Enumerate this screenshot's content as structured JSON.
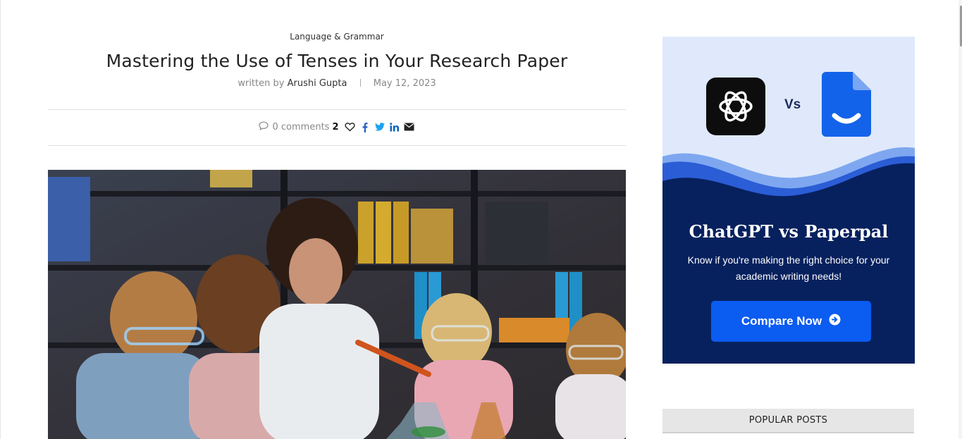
{
  "article": {
    "category": "Language & Grammar",
    "title": "Mastering the Use of Tenses in Your Research Paper",
    "written_by_label": "written by",
    "author": "Arushi Gupta",
    "date": "May 12, 2023",
    "comments": "0 comments",
    "likes": "2",
    "share_icons": [
      "comment-icon",
      "heart-icon",
      "facebook-icon",
      "twitter-icon",
      "linkedin-icon",
      "email-icon"
    ]
  },
  "ad": {
    "vs_label": "Vs",
    "heading": "ChatGPT vs Paperpal",
    "subtext": "Know if you're making the right choice for your academic writing needs!",
    "button_label": "Compare Now",
    "colors": {
      "background": "#dfe9fb",
      "wave_dark": "#07215e",
      "wave_light": "#4f86e8",
      "button": "#0b5cf0"
    }
  },
  "sidebar": {
    "popular_posts_label": "POPULAR POSTS"
  },
  "colors": {
    "facebook": "#2a62c7",
    "twitter": "#1da1f2",
    "linkedin": "#0a66c2"
  }
}
